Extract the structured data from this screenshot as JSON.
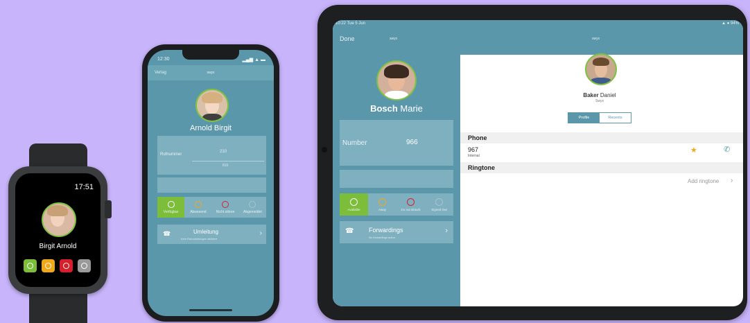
{
  "watch": {
    "time": "17:51",
    "contact_name": "Birgit Arnold",
    "status_buttons": [
      {
        "name": "available",
        "color": "#7cbd3a"
      },
      {
        "name": "away",
        "color": "#f0a81a"
      },
      {
        "name": "do-not-disturb",
        "color": "#d71e2b"
      },
      {
        "name": "signed-out",
        "color": "#9a9a9a"
      }
    ]
  },
  "phone": {
    "status_time": "12:30",
    "status_icons": "▂▄▆ ▲ ▬",
    "nav_back": "Verlag",
    "brand": "swyx",
    "contact_name": "Arnold Birgit",
    "number_label": "Rufnummer",
    "number_value": "210",
    "number_sub": "810",
    "status_labels": [
      "Verfügbar",
      "Abwesend",
      "Nicht stören",
      "Abgemeldet"
    ],
    "forwarding_title": "Umleitung",
    "forwarding_sub": "Kein Rufumleitungen aktiviert"
  },
  "tablet": {
    "status_time": "10:22  Tue 5 Jun",
    "status_right": "▲ ● 94%",
    "done_label": "Done",
    "brand": "swyx",
    "left_name_bold": "Bosch",
    "left_name_rest": " Marie",
    "number_label": "Number",
    "number_value": "966",
    "number_above": "",
    "number_below": "",
    "status_labels": [
      "Available",
      "Away",
      "Do not disturb",
      "Signed Out"
    ],
    "forwardings_title": "Forwardings",
    "forwardings_sub": "No forwardings active",
    "right_name_bold": "Baker",
    "right_name_rest": " Daniel",
    "right_sub": "Swyx",
    "tabs": [
      "Profile",
      "Recents"
    ],
    "phone_section": "Phone",
    "phone_number": "967",
    "phone_type": "Internal",
    "ringtone_section": "Ringtone",
    "add_ringtone": "Add ringtone"
  },
  "icons": {
    "star": "star-icon",
    "call": "phone-icon",
    "chevron": "chevron-right-icon",
    "forward": "call-forward-icon"
  }
}
